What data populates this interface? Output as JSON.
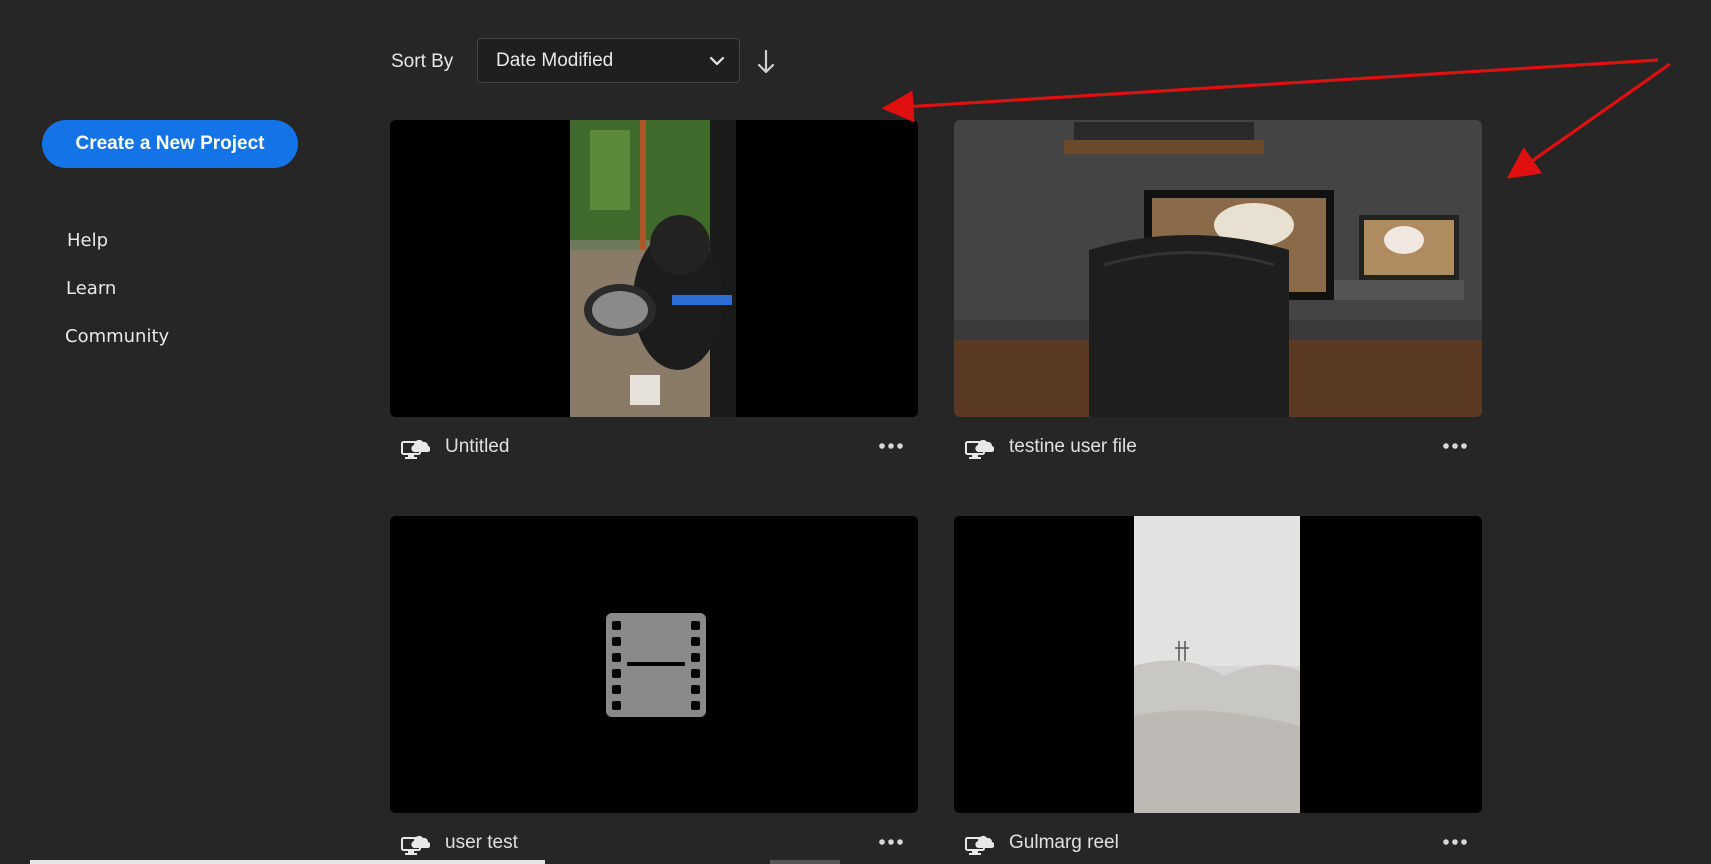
{
  "sidebar": {
    "create_label": "Create a New Project",
    "links": [
      "Help",
      "Learn",
      "Community"
    ]
  },
  "toolbar": {
    "sort_label": "Sort By",
    "sort_value": "Date Modified",
    "sort_direction_icon": "arrow-down-icon"
  },
  "projects": [
    {
      "title": "Untitled",
      "thumbnail": "dog-in-car-window-photo",
      "status_icon": "cloud-sync-icon"
    },
    {
      "title": "testine user file",
      "thumbnail": "desk-with-monitors-photo",
      "status_icon": "cloud-sync-icon"
    },
    {
      "title": "user test",
      "thumbnail": "film-placeholder-icon",
      "status_icon": "cloud-sync-icon"
    },
    {
      "title": "Gulmarg reel",
      "thumbnail": "snow-landscape-photo",
      "status_icon": "cloud-sync-icon"
    }
  ],
  "colors": {
    "background": "#262626",
    "accent": "#1473e6",
    "annotation_arrow": "#e01010"
  }
}
